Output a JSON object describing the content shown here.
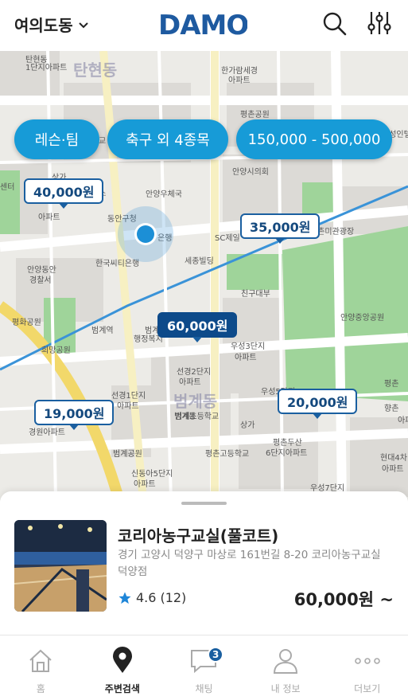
{
  "header": {
    "location": "여의도동",
    "logo": "DAMO",
    "search_icon": "search-icon",
    "filter_icon": "sliders-icon"
  },
  "filters": {
    "category": "레슨·팀",
    "sport": "축구 외 4종목",
    "price_range": "150,000 - 500,000"
  },
  "map": {
    "district_labels": [
      "탄현동",
      "범계동"
    ],
    "place_labels": [
      "탄현동",
      "1단지아파트",
      "한가람세경",
      "아파트",
      "평촌공원",
      "전기차충전소",
      "효성인텔",
      "달안초등학교",
      "안양시청",
      "안양시의회",
      "센터",
      "상가",
      "라스",
      "안양우체국",
      "아파트",
      "동안구청",
      "은행",
      "SC제일",
      "평촌미관광장",
      "안양동안",
      "경찰서",
      "한국씨티은행",
      "세종빌딩",
      "친구대부",
      "안양중앙공원",
      "평화공원",
      "범계역",
      "범계",
      "희망공원",
      "행정복지",
      "우성3단지",
      "아파트",
      "선경2단지",
      "아파트",
      "선경1단지",
      "아파트",
      "범계동",
      "범계초등학교",
      "우성5단지",
      "평촌",
      "향촌",
      "아파트",
      "경원아파트",
      "범계공원",
      "상가",
      "평촌고등학교",
      "평촌두산",
      "6단지아파트",
      "현대4차",
      "아파트",
      "신동아5단지",
      "아파트",
      "우성7단지"
    ],
    "price_markers": [
      {
        "label": "40,000원",
        "active": false
      },
      {
        "label": "35,000원",
        "active": false
      },
      {
        "label": "60,000원",
        "active": true
      },
      {
        "label": "19,000원",
        "active": false
      },
      {
        "label": "20,000원",
        "active": false
      }
    ]
  },
  "venue": {
    "title": "코리아농구교실(풀코트)",
    "address": "경기 고양시 덕양구 마상로 161번길 8-20 코리아농구교실 덕양점",
    "rating": "4.6",
    "review_count": "(12)",
    "price": "60,000원 ~"
  },
  "tabs": [
    {
      "label": "홈",
      "icon": "home-icon",
      "active": false
    },
    {
      "label": "주변검색",
      "icon": "map-pin-icon",
      "active": true
    },
    {
      "label": "채팅",
      "icon": "chat-icon",
      "active": false,
      "badge": "3"
    },
    {
      "label": "내 정보",
      "icon": "user-icon",
      "active": false
    },
    {
      "label": "더보기",
      "icon": "more-icon",
      "active": false
    }
  ],
  "colors": {
    "brand": "#1e5aa0",
    "chip": "#179bd7",
    "active_marker": "#0d4a8a",
    "park": "#8fcf87",
    "rail": "#f2d86a"
  }
}
